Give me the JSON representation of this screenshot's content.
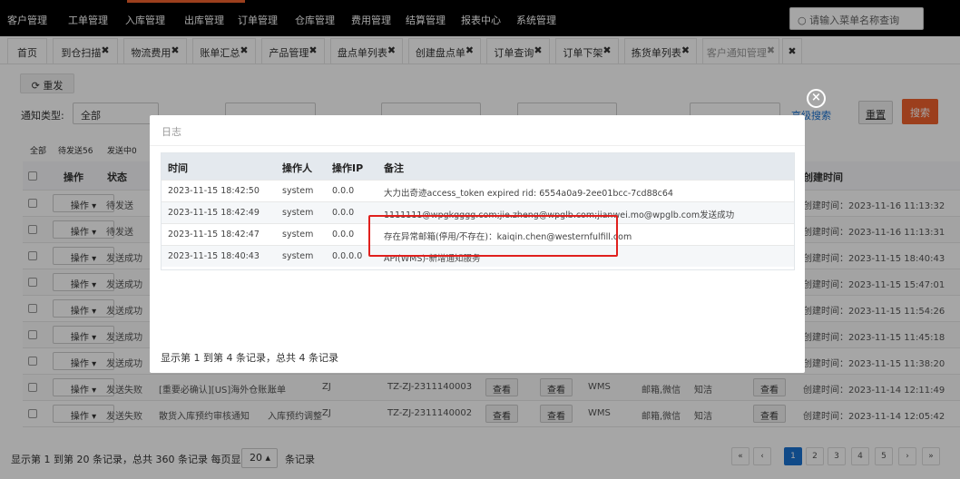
{
  "nav": {
    "items": [
      "客户管理",
      "工单管理",
      "入库管理",
      "出库管理",
      "订单管理",
      "仓库管理",
      "费用管理",
      "结算管理",
      "报表中心",
      "系统管理"
    ],
    "search_placeholder": "请输入菜单名称查询"
  },
  "tabs": [
    {
      "label": "首页",
      "closable": false
    },
    {
      "label": "到仓扫描",
      "closable": true
    },
    {
      "label": "物流费用",
      "closable": true
    },
    {
      "label": "账单汇总",
      "closable": true
    },
    {
      "label": "产品管理",
      "closable": true
    },
    {
      "label": "盘点单列表",
      "closable": true
    },
    {
      "label": "创建盘点单",
      "closable": true
    },
    {
      "label": "订单查询",
      "closable": true
    },
    {
      "label": "订单下架",
      "closable": true
    },
    {
      "label": "拣货单列表",
      "closable": true
    },
    {
      "label": "客户通知管理",
      "closable": true
    }
  ],
  "tab_close_all": "✖",
  "toolbar": {
    "resend_label": "重发"
  },
  "filters": {
    "type_label": "通知类型:",
    "type_value": "全部",
    "more_label": "高级搜索",
    "reset_label": "重置",
    "search_label": "搜索"
  },
  "status_tabs": [
    "全部",
    "待发送56",
    "发送中0"
  ],
  "table": {
    "headers": {
      "op": "操作",
      "status": "状态",
      "created": "创建时间"
    },
    "rows": [
      {
        "op": "操作",
        "status": "待发送",
        "created": "创建时间：2023-11-16 11:13:32"
      },
      {
        "op": "操作",
        "status": "待发送",
        "created": "创建时间：2023-11-16 11:13:31"
      },
      {
        "op": "操作",
        "status": "发送成功",
        "created": "创建时间：2023-11-15 18:40:43"
      },
      {
        "op": "操作",
        "status": "发送成功",
        "created": "创建时间：2023-11-15 15:47:01"
      },
      {
        "op": "操作",
        "status": "发送成功",
        "created": "创建时间：2023-11-15 11:54:26"
      },
      {
        "op": "操作",
        "status": "发送成功",
        "created": "创建时间：2023-11-15 11:45:18"
      },
      {
        "op": "操作",
        "status": "发送成功",
        "created": "创建时间：2023-11-15 11:38:20"
      },
      {
        "op": "操作",
        "status": "发送失败",
        "title": "[重要必确认][US]海外仓账...",
        "ttype": "账单",
        "code": "ZJ",
        "order": "TZ-ZJ-2311140003",
        "v1": "查看",
        "v2": "查看",
        "sys": "WMS",
        "chan": "邮箱,微信",
        "who": "知洁",
        "v3": "查看",
        "created": "创建时间：2023-11-14 12:11:49"
      },
      {
        "op": "操作",
        "status": "发送失败",
        "title": "散货入库预约审核通知",
        "ttype": "入库预约调整",
        "code": "ZJ",
        "order": "TZ-ZJ-2311140002",
        "v1": "查看",
        "v2": "查看",
        "sys": "WMS",
        "chan": "邮箱,微信",
        "who": "知洁",
        "v3": "查看",
        "created": "创建时间：2023-11-14 12:05:42"
      }
    ]
  },
  "footer": {
    "summary": "显示第 1 到第 20 条记录，总共 360 条记录 每页显示",
    "page_size": "20",
    "unit": "条记录",
    "pages": [
      "«",
      "‹",
      "1",
      "2",
      "3",
      "4",
      "5",
      "›",
      "»"
    ]
  },
  "dialog": {
    "title": "日志",
    "headers": {
      "time": "时间",
      "user": "操作人",
      "ip": "操作IP",
      "note": "备注"
    },
    "rows": [
      {
        "time": "2023-11-15 18:42:50",
        "user": "system",
        "ip": "0.0.0",
        "note": "大力出奇迹access_token expired rid: 6554a0a9-2ee01bcc-7cd88c64"
      },
      {
        "time": "2023-11-15 18:42:49",
        "user": "system",
        "ip": "0.0.0",
        "note": "1111111@wpgkgggg.com;jie.zheng@wpglb.com;jianwei.mo@wpglb.com发送成功"
      },
      {
        "time": "2023-11-15 18:42:47",
        "user": "system",
        "ip": "0.0.0",
        "note": "存在异常邮箱(停用/不存在)：kaiqin.chen@westernfulfill.com"
      },
      {
        "time": "2023-11-15 18:40:43",
        "user": "system",
        "ip": "0.0.0.0",
        "note": "API(WMS)-新增通知服务"
      }
    ],
    "footer": "显示第 1 到第 4 条记录，总共 4 条记录"
  },
  "colors": {
    "accent": "#f0622d",
    "link": "#1a72d1",
    "highlight": "#e0201d"
  }
}
